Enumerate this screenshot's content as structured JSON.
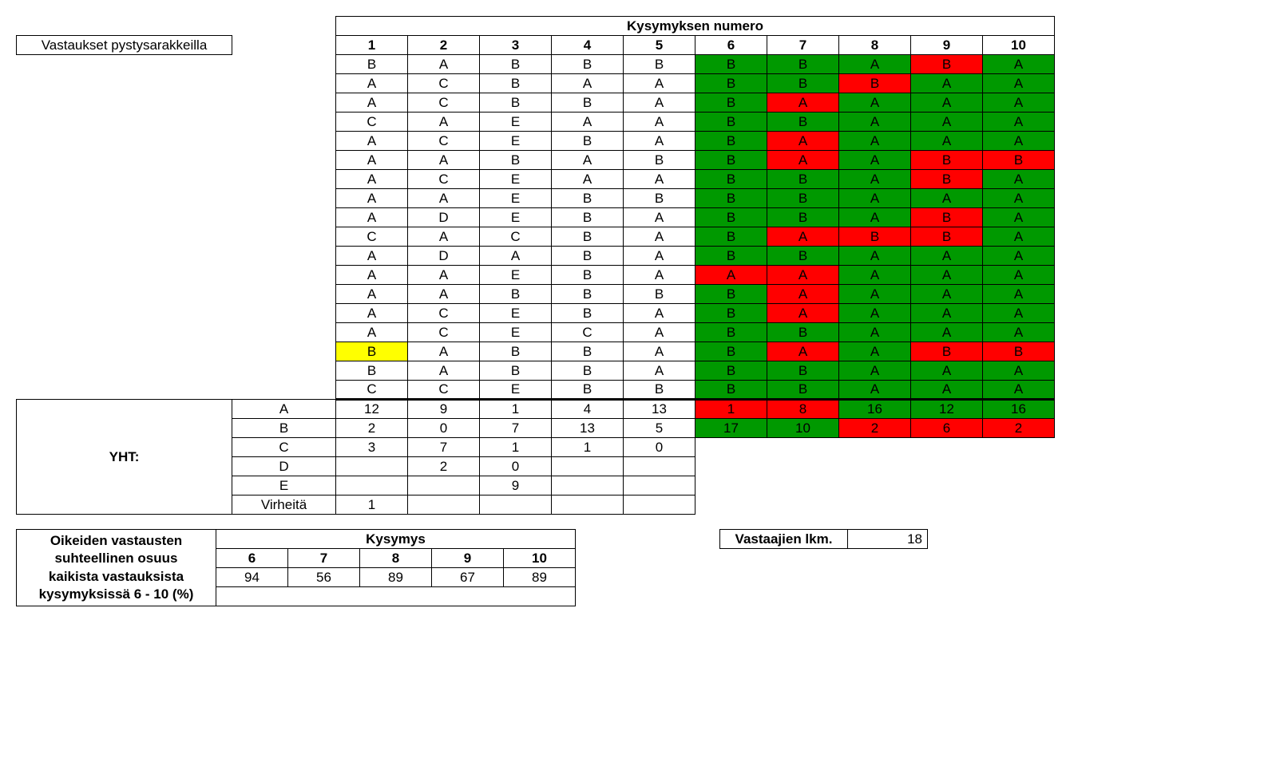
{
  "header": {
    "top": "Kysymyksen numero",
    "side": "Vastaukset pystysarakkeilla",
    "cols": [
      "1",
      "2",
      "3",
      "4",
      "5",
      "6",
      "7",
      "8",
      "9",
      "10"
    ]
  },
  "rows": [
    {
      "c": [
        {
          "v": "B"
        },
        {
          "v": "A"
        },
        {
          "v": "B"
        },
        {
          "v": "B"
        },
        {
          "v": "B"
        },
        {
          "v": "B",
          "bg": "green"
        },
        {
          "v": "B",
          "bg": "green"
        },
        {
          "v": "A",
          "bg": "green"
        },
        {
          "v": "B",
          "bg": "red"
        },
        {
          "v": "A",
          "bg": "green"
        }
      ]
    },
    {
      "c": [
        {
          "v": "A"
        },
        {
          "v": "C"
        },
        {
          "v": "B"
        },
        {
          "v": "A"
        },
        {
          "v": "A"
        },
        {
          "v": "B",
          "bg": "green"
        },
        {
          "v": "B",
          "bg": "green"
        },
        {
          "v": "B",
          "bg": "red"
        },
        {
          "v": "A",
          "bg": "green"
        },
        {
          "v": "A",
          "bg": "green"
        }
      ]
    },
    {
      "c": [
        {
          "v": "A"
        },
        {
          "v": "C"
        },
        {
          "v": "B"
        },
        {
          "v": "B"
        },
        {
          "v": "A"
        },
        {
          "v": "B",
          "bg": "green"
        },
        {
          "v": "A",
          "bg": "red"
        },
        {
          "v": "A",
          "bg": "green"
        },
        {
          "v": "A",
          "bg": "green"
        },
        {
          "v": "A",
          "bg": "green"
        }
      ]
    },
    {
      "c": [
        {
          "v": "C"
        },
        {
          "v": "A"
        },
        {
          "v": "E"
        },
        {
          "v": "A"
        },
        {
          "v": "A"
        },
        {
          "v": "B",
          "bg": "green"
        },
        {
          "v": "B",
          "bg": "green"
        },
        {
          "v": "A",
          "bg": "green"
        },
        {
          "v": "A",
          "bg": "green"
        },
        {
          "v": "A",
          "bg": "green"
        }
      ]
    },
    {
      "c": [
        {
          "v": "A"
        },
        {
          "v": "C"
        },
        {
          "v": "E"
        },
        {
          "v": "B"
        },
        {
          "v": "A"
        },
        {
          "v": "B",
          "bg": "green"
        },
        {
          "v": "A",
          "bg": "red"
        },
        {
          "v": "A",
          "bg": "green"
        },
        {
          "v": "A",
          "bg": "green"
        },
        {
          "v": "A",
          "bg": "green"
        }
      ]
    },
    {
      "c": [
        {
          "v": "A"
        },
        {
          "v": "A"
        },
        {
          "v": "B"
        },
        {
          "v": "A"
        },
        {
          "v": "B"
        },
        {
          "v": "B",
          "bg": "green"
        },
        {
          "v": "A",
          "bg": "red"
        },
        {
          "v": "A",
          "bg": "green"
        },
        {
          "v": "B",
          "bg": "red"
        },
        {
          "v": "B",
          "bg": "red"
        }
      ]
    },
    {
      "c": [
        {
          "v": "A"
        },
        {
          "v": "C"
        },
        {
          "v": "E"
        },
        {
          "v": "A"
        },
        {
          "v": "A"
        },
        {
          "v": "B",
          "bg": "green"
        },
        {
          "v": "B",
          "bg": "green"
        },
        {
          "v": "A",
          "bg": "green"
        },
        {
          "v": "B",
          "bg": "red"
        },
        {
          "v": "A",
          "bg": "green"
        }
      ]
    },
    {
      "c": [
        {
          "v": "A"
        },
        {
          "v": "A"
        },
        {
          "v": "E"
        },
        {
          "v": "B"
        },
        {
          "v": "B"
        },
        {
          "v": "B",
          "bg": "green"
        },
        {
          "v": "B",
          "bg": "green"
        },
        {
          "v": "A",
          "bg": "green"
        },
        {
          "v": "A",
          "bg": "green"
        },
        {
          "v": "A",
          "bg": "green"
        }
      ]
    },
    {
      "c": [
        {
          "v": "A"
        },
        {
          "v": "D"
        },
        {
          "v": "E"
        },
        {
          "v": "B"
        },
        {
          "v": "A"
        },
        {
          "v": "B",
          "bg": "green"
        },
        {
          "v": "B",
          "bg": "green"
        },
        {
          "v": "A",
          "bg": "green"
        },
        {
          "v": "B",
          "bg": "red"
        },
        {
          "v": "A",
          "bg": "green"
        }
      ]
    },
    {
      "c": [
        {
          "v": "C"
        },
        {
          "v": "A"
        },
        {
          "v": "C"
        },
        {
          "v": "B"
        },
        {
          "v": "A"
        },
        {
          "v": "B",
          "bg": "green"
        },
        {
          "v": "A",
          "bg": "red"
        },
        {
          "v": "B",
          "bg": "red"
        },
        {
          "v": "B",
          "bg": "red"
        },
        {
          "v": "A",
          "bg": "green"
        }
      ]
    },
    {
      "c": [
        {
          "v": "A"
        },
        {
          "v": "D"
        },
        {
          "v": "A"
        },
        {
          "v": "B"
        },
        {
          "v": "A"
        },
        {
          "v": "B",
          "bg": "green"
        },
        {
          "v": "B",
          "bg": "green"
        },
        {
          "v": "A",
          "bg": "green"
        },
        {
          "v": "A",
          "bg": "green"
        },
        {
          "v": "A",
          "bg": "green"
        }
      ]
    },
    {
      "c": [
        {
          "v": "A"
        },
        {
          "v": "A"
        },
        {
          "v": "E"
        },
        {
          "v": "B"
        },
        {
          "v": "A"
        },
        {
          "v": "A",
          "bg": "red"
        },
        {
          "v": "A",
          "bg": "red"
        },
        {
          "v": "A",
          "bg": "green"
        },
        {
          "v": "A",
          "bg": "green"
        },
        {
          "v": "A",
          "bg": "green"
        }
      ]
    },
    {
      "c": [
        {
          "v": "A"
        },
        {
          "v": "A"
        },
        {
          "v": "B"
        },
        {
          "v": "B"
        },
        {
          "v": "B"
        },
        {
          "v": "B",
          "bg": "green"
        },
        {
          "v": "A",
          "bg": "red"
        },
        {
          "v": "A",
          "bg": "green"
        },
        {
          "v": "A",
          "bg": "green"
        },
        {
          "v": "A",
          "bg": "green"
        }
      ]
    },
    {
      "c": [
        {
          "v": "A"
        },
        {
          "v": "C"
        },
        {
          "v": "E"
        },
        {
          "v": "B"
        },
        {
          "v": "A"
        },
        {
          "v": "B",
          "bg": "green"
        },
        {
          "v": "A",
          "bg": "red"
        },
        {
          "v": "A",
          "bg": "green"
        },
        {
          "v": "A",
          "bg": "green"
        },
        {
          "v": "A",
          "bg": "green"
        }
      ]
    },
    {
      "c": [
        {
          "v": "A"
        },
        {
          "v": "C"
        },
        {
          "v": "E"
        },
        {
          "v": "C"
        },
        {
          "v": "A"
        },
        {
          "v": "B",
          "bg": "green"
        },
        {
          "v": "B",
          "bg": "green"
        },
        {
          "v": "A",
          "bg": "green"
        },
        {
          "v": "A",
          "bg": "green"
        },
        {
          "v": "A",
          "bg": "green"
        }
      ]
    },
    {
      "c": [
        {
          "v": "B",
          "bg": "yellow"
        },
        {
          "v": "A"
        },
        {
          "v": "B"
        },
        {
          "v": "B"
        },
        {
          "v": "A"
        },
        {
          "v": "B",
          "bg": "green"
        },
        {
          "v": "A",
          "bg": "red"
        },
        {
          "v": "A",
          "bg": "green"
        },
        {
          "v": "B",
          "bg": "red"
        },
        {
          "v": "B",
          "bg": "red"
        }
      ]
    },
    {
      "c": [
        {
          "v": "B"
        },
        {
          "v": "A"
        },
        {
          "v": "B"
        },
        {
          "v": "B"
        },
        {
          "v": "A"
        },
        {
          "v": "B",
          "bg": "green"
        },
        {
          "v": "B",
          "bg": "green"
        },
        {
          "v": "A",
          "bg": "green"
        },
        {
          "v": "A",
          "bg": "green"
        },
        {
          "v": "A",
          "bg": "green"
        }
      ]
    },
    {
      "c": [
        {
          "v": "C"
        },
        {
          "v": "C"
        },
        {
          "v": "E"
        },
        {
          "v": "B"
        },
        {
          "v": "B"
        },
        {
          "v": "B",
          "bg": "green"
        },
        {
          "v": "B",
          "bg": "green"
        },
        {
          "v": "A",
          "bg": "green"
        },
        {
          "v": "A",
          "bg": "green"
        },
        {
          "v": "A",
          "bg": "green"
        }
      ]
    }
  ],
  "totals": {
    "label": "YHT:",
    "rows": [
      {
        "k": "A",
        "v": [
          "12",
          "9",
          "1",
          "4",
          "13",
          {
            "v": "1",
            "bg": "red"
          },
          {
            "v": "8",
            "bg": "red"
          },
          {
            "v": "16",
            "bg": "green"
          },
          {
            "v": "12",
            "bg": "green"
          },
          {
            "v": "16",
            "bg": "green"
          }
        ]
      },
      {
        "k": "B",
        "v": [
          "2",
          "0",
          "7",
          "13",
          "5",
          {
            "v": "17",
            "bg": "green"
          },
          {
            "v": "10",
            "bg": "green"
          },
          {
            "v": "2",
            "bg": "red"
          },
          {
            "v": "6",
            "bg": "red"
          },
          {
            "v": "2",
            "bg": "red"
          }
        ]
      },
      {
        "k": "C",
        "v": [
          "3",
          "7",
          "1",
          "1",
          "0"
        ]
      },
      {
        "k": "D",
        "v": [
          "",
          "2",
          "0",
          "",
          ""
        ]
      },
      {
        "k": "E",
        "v": [
          "",
          "",
          "9",
          "",
          ""
        ]
      },
      {
        "k": "Virheitä",
        "v": [
          "1",
          "",
          "",
          "",
          ""
        ]
      }
    ]
  },
  "pct": {
    "label_lines": [
      "Oikeiden vastausten",
      "suhteellinen osuus",
      "kaikista vastauksista",
      "kysymyksissä 6 - 10 (%)"
    ],
    "header": "Kysymys",
    "cols": [
      "6",
      "7",
      "8",
      "9",
      "10"
    ],
    "vals": [
      "94",
      "56",
      "89",
      "67",
      "89"
    ]
  },
  "count": {
    "label": "Vastaajien lkm.",
    "value": "18"
  }
}
